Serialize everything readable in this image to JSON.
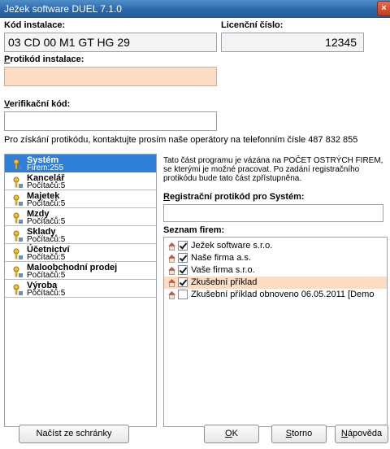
{
  "window": {
    "title": "Ježek software DUEL 7.1.0",
    "close_glyph": "×"
  },
  "form": {
    "kod_instalace_label": "Kód instalace:",
    "kod_instalace_value": "03 CD 00 M1 GT HG 29",
    "licencni_cislo_label": "Licenční číslo:",
    "licencni_cislo_value": "12345",
    "protikod_label_hot": "P",
    "protikod_label_rest": "rotikód instalace:",
    "protikod_value": "",
    "verifikacni_label_hot": "V",
    "verifikacni_label_rest": "erifikační kód:",
    "verifikacni_value": ""
  },
  "info_text": "Pro získání protikódu, kontaktujte prosím naše operátory na telefonním čísle 487 832 855",
  "modules": [
    {
      "name": "Systém",
      "count": "Firem:255",
      "selected": true
    },
    {
      "name": "Kancelář",
      "count": "Počítačů:5"
    },
    {
      "name": "Majetek",
      "count": "Počítačů:5"
    },
    {
      "name": "Mzdy",
      "count": "Počítačů:5"
    },
    {
      "name": "Sklady",
      "count": "Počítačů:5"
    },
    {
      "name": "Účetnictví",
      "count": "Počítačů:5"
    },
    {
      "name": "Maloobchodní prodej",
      "count": "Počítačů:5"
    },
    {
      "name": "Výroba",
      "count": "Počítačů:5"
    }
  ],
  "description": {
    "line1": "Tato část programu je vázána na POČET OSTRÝCH FIREM,",
    "line2": "se kterými je možné pracovat. Po zadání registračního",
    "line3": "protikódu bude tato část zpřístupněna."
  },
  "reg_label_hot": "R",
  "reg_label_rest": "egistrační protikód pro Systém:",
  "firms_label": "Seznam firem:",
  "firms": [
    {
      "name": "Ježek software s.r.o.",
      "checked": true
    },
    {
      "name": "Naše firma a.s.",
      "checked": true
    },
    {
      "name": "Vaše firma s.r.o.",
      "checked": true
    },
    {
      "name": "Zkušební příklad",
      "checked": true,
      "highlight": true
    },
    {
      "name": "Zkušební příklad obnoveno 06.05.2011 [Demo",
      "checked": false
    }
  ],
  "buttons": {
    "paste": "Načíst ze schránky",
    "ok_hot": "O",
    "ok_rest": "K",
    "cancel_hot": "S",
    "cancel_rest": "torno",
    "help_hot": "N",
    "help_rest": "ápověda"
  },
  "colors": {
    "selection": "#2f7fd8",
    "peach": "#fddcc4",
    "titlebar": "#2a66a8"
  }
}
